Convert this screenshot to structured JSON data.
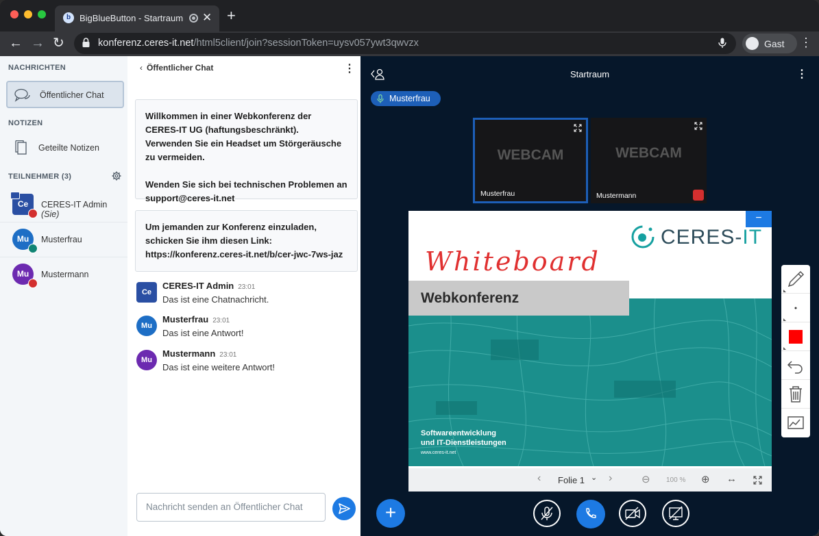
{
  "browser": {
    "tab_title": "BigBlueButton - Startraum",
    "url_host": "konferenz.ceres-it.net",
    "url_path": "/html5client/join?sessionToken=uysv057ywt3qwvzx",
    "profile_label": "Gast",
    "new_tab": "+",
    "close": "✕"
  },
  "sidebar": {
    "messages_heading": "NACHRICHTEN",
    "public_chat": "Öffentlicher Chat",
    "notes_heading": "NOTIZEN",
    "shared_notes": "Geteilte Notizen",
    "participants_heading": "TEILNEHMER (3)",
    "users": [
      {
        "initials": "Ce",
        "name": "CERES-IT Admin",
        "suffix": "(Sie)",
        "color": "#2a4fa3"
      },
      {
        "initials": "Mu",
        "name": "Musterfrau",
        "suffix": "",
        "color": "#1d6ec5"
      },
      {
        "initials": "Mu",
        "name": "Mustermann",
        "suffix": "",
        "color": "#6c2ab0"
      }
    ]
  },
  "chat": {
    "header": "Öffentlicher Chat",
    "welcome_1": "Willkommen in einer Webkonferenz der CERES-IT UG (haftungsbeschränkt). Verwenden Sie ein Headset um Störgeräusche zu vermeiden.",
    "welcome_2": "Wenden Sie sich bei technischen Problemen an support@ceres-it.net",
    "invite_1": "Um jemanden zur Konferenz einzuladen, schicken Sie ihm diesen Link:",
    "invite_2": "https://konferenz.ceres-it.net/b/cer-jwc-7ws-jaz",
    "messages": [
      {
        "initials": "Ce",
        "author": "CERES-IT Admin",
        "time": "23:01",
        "text": "Das ist eine Chatnachricht.",
        "color": "#2a4fa3"
      },
      {
        "initials": "Mu",
        "author": "Musterfrau",
        "time": "23:01",
        "text": "Das ist eine Antwort!",
        "color": "#1d6ec5"
      },
      {
        "initials": "Mu",
        "author": "Mustermann",
        "time": "23:01",
        "text": "Das ist eine weitere Antwort!",
        "color": "#6c2ab0"
      }
    ],
    "input_placeholder": "Nachricht senden an Öffentlicher Chat"
  },
  "main": {
    "room_title": "Startraum",
    "talking": "Musterfrau",
    "webcams": [
      {
        "label": "WEBCAM",
        "name": "Musterfrau"
      },
      {
        "label": "WEBCAM",
        "name": "Mustermann"
      }
    ]
  },
  "slide": {
    "logo_left": "CERES-",
    "logo_right": "IT",
    "handwriting": "Whiteboard",
    "title": "Webkonferenz",
    "subtitle_1": "Softwareentwicklung",
    "subtitle_2": "und IT-Dienstleistungen",
    "website": "www.ceres-it.net",
    "slide_label": "Folie 1",
    "zoom": "100 %"
  }
}
